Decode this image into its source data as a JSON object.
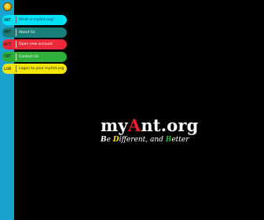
{
  "menu": {
    "items": [
      {
        "code": "ANT",
        "label": "What is myAnt.org?"
      },
      {
        "code": "ABT",
        "label": "About Us"
      },
      {
        "code": "ACT",
        "label": "Open new account"
      },
      {
        "code": "CNT",
        "label": "Contact Us"
      },
      {
        "code": "LGN",
        "label": "Logon to your myAnt.org"
      }
    ]
  },
  "logo": {
    "pre": "my",
    "accent": "A",
    "post": "nt.org"
  },
  "tagline": {
    "b": "B",
    "part1": "e ",
    "d": "D",
    "part2": "ifferent, and ",
    "bt": "B",
    "part3": "etter"
  },
  "colors": {
    "background": "#1aa3cc",
    "panel": "#000000",
    "menu": [
      "#00e3f7",
      "#1a7f7a",
      "#ea2a3a",
      "#2fb03a",
      "#f5e70a"
    ]
  },
  "icons": {
    "corner": "ant-logo-icon"
  }
}
